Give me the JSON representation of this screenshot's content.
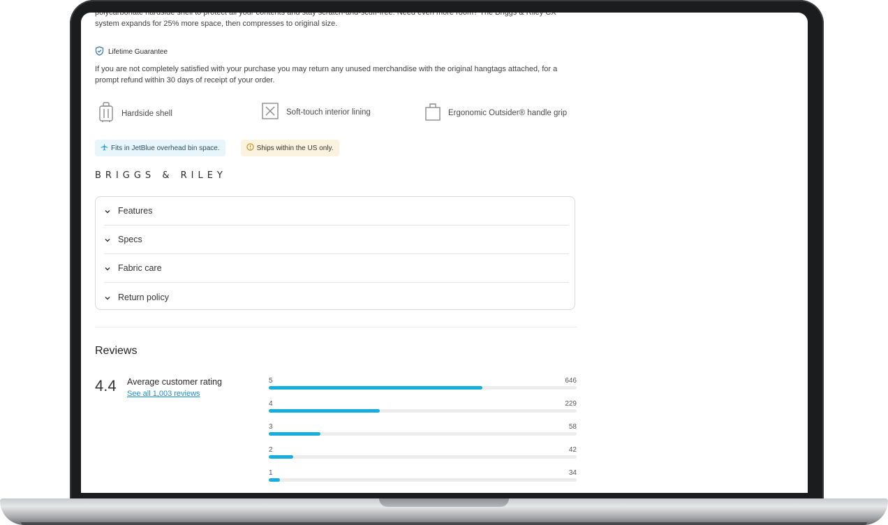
{
  "product": {
    "description": "polycarbonate hardside shell to protect all your contents and stay scratch-and-scuff-free. Need even more room? The Briggs & Riley CX™ system expands for 25% more space, then compresses to original size.",
    "guarantee_title": "Lifetime Guarantee",
    "guarantee_text": "If you are not completely satisfied with your purchase  you may return any unused merchandise with the original hangtags attached, for a prompt refund within 30 days of receipt of your order.",
    "features": [
      {
        "label": "Hardside shell",
        "icon": "luggage-icon"
      },
      {
        "label": "Soft-touch interior lining",
        "icon": "lining-icon"
      },
      {
        "label": "Ergonomic Outsider® handle grip",
        "icon": "bag-handle-icon"
      }
    ],
    "badges": {
      "jetblue": "Fits in JetBlue overhead bin space.",
      "shipping": "Ships within the US only."
    },
    "brand": "BRIGGS & RILEY"
  },
  "accordion": [
    {
      "label": "Features"
    },
    {
      "label": "Specs"
    },
    {
      "label": "Fabric care"
    },
    {
      "label": "Return policy"
    }
  ],
  "reviews": {
    "title": "Reviews",
    "average": "4.4",
    "average_label": "Average customer rating",
    "see_all": "See all 1,003 reviews",
    "distribution": [
      {
        "stars": "5",
        "count": "646",
        "fraction": 0.695
      },
      {
        "stars": "4",
        "count": "229",
        "fraction": 0.36
      },
      {
        "stars": "3",
        "count": "58",
        "fraction": 0.168
      },
      {
        "stars": "2",
        "count": "42",
        "fraction": 0.08
      },
      {
        "stars": "1",
        "count": "34",
        "fraction": 0.037
      }
    ]
  },
  "colors": {
    "accent": "#16aedc",
    "link": "#1a8fc7",
    "badge_blue_bg": "#e8f5fb",
    "badge_yellow_bg": "#fbf3e0"
  }
}
